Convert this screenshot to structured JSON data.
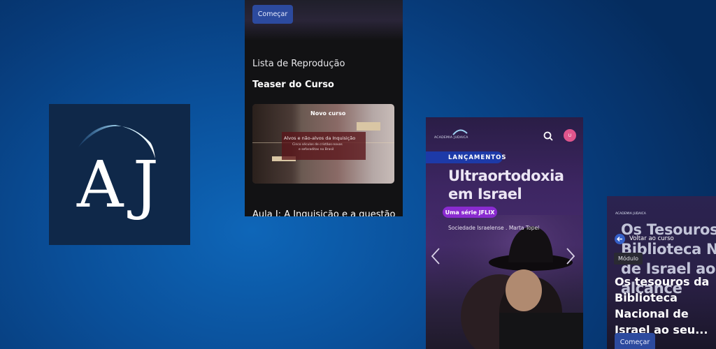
{
  "logo": {
    "letters_a": "A",
    "letters_j": "J",
    "icon": "aj-logo-icon",
    "colors": {
      "tile": "#0f2849",
      "arc": "#8fc9ee"
    }
  },
  "screen_playlist": {
    "start_button": "Começar",
    "section_title": "Lista de Reprodução",
    "teaser_title": "Teaser do Curso",
    "thumbnail": {
      "tag": "Novo curso",
      "headline": "Alvos e não-alvos da Inquisição",
      "subtitle_line1": "Cinco séculos de cristãos-novos",
      "subtitle_line2": "e sefaraditas no Brasil"
    },
    "lesson_title": "Aula I: A Inquisição e a questão"
  },
  "screen_jflix": {
    "brand": "ACADEMIA JUDAICA",
    "search_icon": "search-icon",
    "avatar_initial": "U",
    "badge": "LANÇAMENTOS",
    "title_line1": "Ultraortodoxia",
    "title_line2": "em Israel",
    "series_tag": "Uma série JFLIX",
    "credits": "Sociedade Israelense  .  Marta Topel",
    "prev_icon": "chevron-left-icon",
    "next_icon": "chevron-right-icon"
  },
  "screen_module": {
    "brand": "ACADEMIA JUDAICA",
    "bg_title_line1": "Os Tesouros",
    "bg_title_line2": "Biblioteca Nac",
    "bg_title_line3": "de Israel ao",
    "bg_title_line4": "alcance",
    "back_label": "Voltar ao curso",
    "module_tag": "Módulo",
    "title": "Os tesouros da Biblioteca Nacional de Israel ao seu...",
    "start_button": "Começar"
  }
}
